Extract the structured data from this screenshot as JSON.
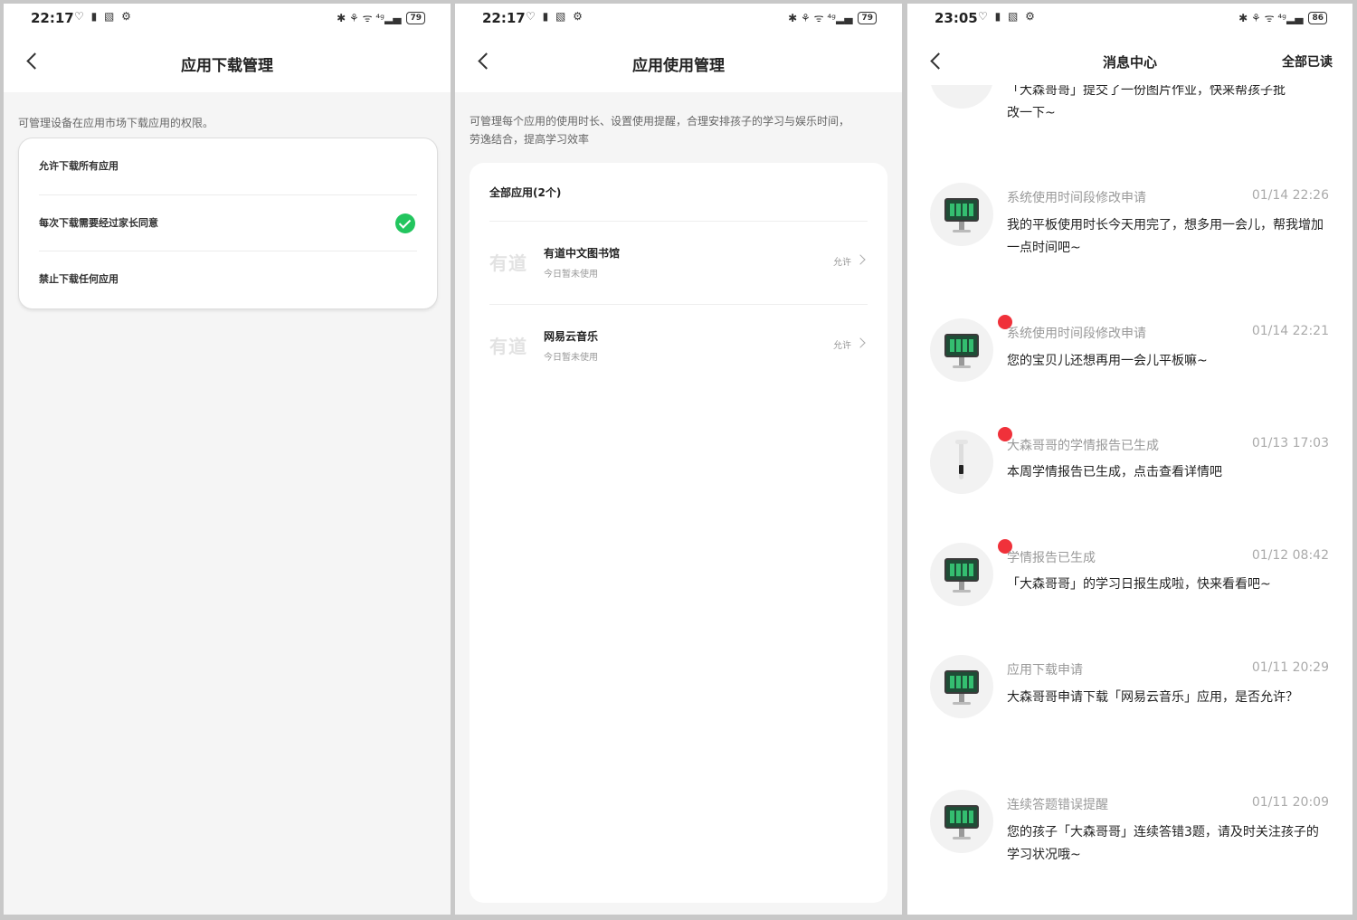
{
  "screen1": {
    "status": {
      "time": "22:17",
      "left_icons": "♡ ▮ ▧ ⚙",
      "right_icons": "✱ ⚘ ᯤ ⁴ᵍ▂▄",
      "battery": "79"
    },
    "nav_title": "应用下载管理",
    "hint": "可管理设备在应用市场下载应用的权限。",
    "options": [
      {
        "label": "允许下载所有应用"
      },
      {
        "label": "每次下载需要经过家长同意"
      },
      {
        "label": "禁止下载任何应用"
      }
    ]
  },
  "screen2": {
    "status": {
      "time": "22:17",
      "left_icons": "♡ ▮ ▧ ⚙",
      "right_icons": "✱ ⚘ ᯤ ⁴ᵍ▂▄",
      "battery": "79"
    },
    "nav_title": "应用使用管理",
    "hint_line1": "可管理每个应用的使用时长、设置使用提醒，合理安排孩子的学习与娱乐时间，",
    "hint_line2": "劳逸结合，提高学习效率",
    "section_title": "全部应用(2个)",
    "apps": [
      {
        "logo": "有道",
        "name": "有道中文图书馆",
        "sub": "今日暂未使用",
        "status": "允许"
      },
      {
        "logo": "有道",
        "name": "网易云音乐",
        "sub": "今日暂未使用",
        "status": "允许"
      }
    ]
  },
  "screen3": {
    "status": {
      "time": "23:05",
      "left_icons": "♡ ▮ ▧ ⚙",
      "right_icons": "✱ ⚘ ᯤ ⁴ᵍ▂▄",
      "battery": "86"
    },
    "nav_title": "消息中心",
    "nav_action": "全部已读",
    "partial_message": {
      "line1": "「大森哥哥」提交了一份图片作业，快来帮孩子批",
      "line2": "改一下~"
    },
    "messages": [
      {
        "type": "系统使用时间段修改申请",
        "time": "01/14 22:26",
        "text": "我的平板使用时长今天用完了，想多用一会儿，帮我增加一点时间吧~"
      },
      {
        "type": "系统使用时间段修改申请",
        "time": "01/14 22:21",
        "text": "您的宝贝儿还想再用一会儿平板嘛~"
      },
      {
        "type": "大森哥哥的学情报告已生成",
        "time": "01/13 17:03",
        "text": "本周学情报告已生成，点击查看详情吧"
      },
      {
        "type": "学情报告已生成",
        "time": "01/12 08:42",
        "text": "「大森哥哥」的学习日报生成啦，快来看看吧~"
      },
      {
        "type": "应用下载申请",
        "time": "01/11 20:29",
        "text": "大森哥哥申请下载「网易云音乐」应用，是否允许？"
      },
      {
        "type": "连续答题错误提醒",
        "time": "01/11 20:09",
        "text": "您的孩子「大森哥哥」连续答错3题，请及时关注孩子的学习状况哦~"
      }
    ]
  },
  "colors": {
    "accent_green": "#22c55e",
    "badge_red": "#f0313a"
  }
}
